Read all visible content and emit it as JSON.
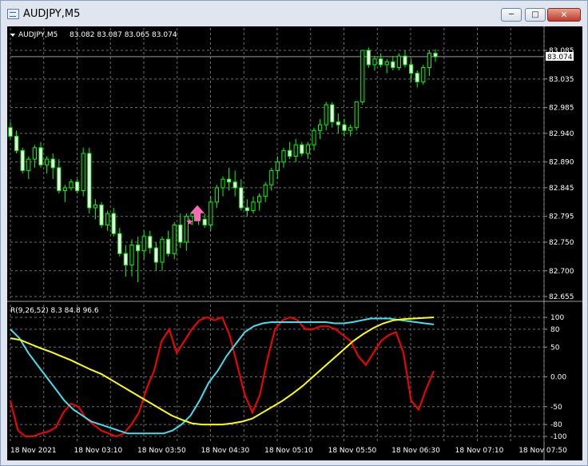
{
  "window": {
    "title": "AUDJPY,M5",
    "minimize_label": "─",
    "maximize_label": "□",
    "close_label": "✕"
  },
  "colors": {
    "background": "#000000",
    "grid": "#6e6e6e",
    "candle": "#00ff00",
    "bull_body": "#000000",
    "bear_body": "#ffffff",
    "rsi_red": "#ff0000",
    "rsi_cyan": "#40e0f0",
    "rsi_yellow": "#ffff00",
    "arrow_pink": "#ff69b4"
  },
  "icons": {
    "dropdown": "triangle-down-icon",
    "buy_arrow": "up-arrow-icon",
    "star": "star-icon"
  },
  "chart_data": [
    {
      "type": "candlestick",
      "symbol_label": "AUDJPY,M5",
      "ohlc_label": "83.082 83.087 83.065 83.074",
      "current_price_label": "83.074",
      "y_ticks": [
        "83.085",
        "83.035",
        "82.985",
        "82.940",
        "82.890",
        "82.845",
        "82.795",
        "82.750",
        "82.700",
        "82.655"
      ],
      "ylim": [
        82.655,
        83.085
      ],
      "candles": [
        [
          82.95,
          82.96,
          82.93,
          82.935
        ],
        [
          82.935,
          82.945,
          82.905,
          82.91
        ],
        [
          82.91,
          82.915,
          82.87,
          82.875
        ],
        [
          82.875,
          82.9,
          82.86,
          82.895
        ],
        [
          82.895,
          82.92,
          82.88,
          82.915
        ],
        [
          82.915,
          82.925,
          82.88,
          82.885
        ],
        [
          82.885,
          82.9,
          82.87,
          82.895
        ],
        [
          82.895,
          82.905,
          82.86,
          82.88
        ],
        [
          82.88,
          82.895,
          82.835,
          82.84
        ],
        [
          82.84,
          82.85,
          82.82,
          82.845
        ],
        [
          82.845,
          82.86,
          82.84,
          82.855
        ],
        [
          82.855,
          82.86,
          82.835,
          82.84
        ],
        [
          82.84,
          82.915,
          82.83,
          82.905
        ],
        [
          82.905,
          82.915,
          82.8,
          82.81
        ],
        [
          82.81,
          82.825,
          82.79,
          82.815
        ],
        [
          82.815,
          82.82,
          82.775,
          82.78
        ],
        [
          82.78,
          82.805,
          82.77,
          82.8
        ],
        [
          82.8,
          82.81,
          82.76,
          82.765
        ],
        [
          82.765,
          82.775,
          82.725,
          82.73
        ],
        [
          82.73,
          82.745,
          82.69,
          82.71
        ],
        [
          82.71,
          82.755,
          82.69,
          82.745
        ],
        [
          82.745,
          82.76,
          82.68,
          82.735
        ],
        [
          82.735,
          82.77,
          82.72,
          82.76
        ],
        [
          82.76,
          82.77,
          82.73,
          82.74
        ],
        [
          82.74,
          82.75,
          82.7,
          82.715
        ],
        [
          82.715,
          82.76,
          82.7,
          82.755
        ],
        [
          82.755,
          82.77,
          82.725,
          82.73
        ],
        [
          82.73,
          82.785,
          82.72,
          82.78
        ],
        [
          82.78,
          82.8,
          82.74,
          82.75
        ],
        [
          82.75,
          82.8,
          82.735,
          82.795
        ],
        [
          82.795,
          82.805,
          82.78,
          82.8
        ],
        [
          82.8,
          82.81,
          82.78,
          82.79
        ],
        [
          82.79,
          82.8,
          82.775,
          82.78
        ],
        [
          82.78,
          82.83,
          82.77,
          82.82
        ],
        [
          82.82,
          82.85,
          82.81,
          82.845
        ],
        [
          82.845,
          82.865,
          82.83,
          82.86
        ],
        [
          82.86,
          82.88,
          82.84,
          82.855
        ],
        [
          82.855,
          82.875,
          82.83,
          82.845
        ],
        [
          82.845,
          82.86,
          82.805,
          82.81
        ],
        [
          82.81,
          82.825,
          82.795,
          82.805
        ],
        [
          82.805,
          82.83,
          82.8,
          82.82
        ],
        [
          82.82,
          82.835,
          82.805,
          82.83
        ],
        [
          82.83,
          82.855,
          82.82,
          82.85
        ],
        [
          82.85,
          82.88,
          82.84,
          82.875
        ],
        [
          82.875,
          82.9,
          82.86,
          82.89
        ],
        [
          82.89,
          82.915,
          82.88,
          82.91
        ],
        [
          82.91,
          82.925,
          82.895,
          82.9
        ],
        [
          82.9,
          82.93,
          82.89,
          82.92
        ],
        [
          82.92,
          82.925,
          82.9,
          82.905
        ],
        [
          82.905,
          82.925,
          82.895,
          82.92
        ],
        [
          82.92,
          82.95,
          82.91,
          82.945
        ],
        [
          82.945,
          82.965,
          82.93,
          82.955
        ],
        [
          82.955,
          82.995,
          82.945,
          82.99
        ],
        [
          82.99,
          82.995,
          82.95,
          82.96
        ],
        [
          82.96,
          82.975,
          82.94,
          82.955
        ],
        [
          82.955,
          82.965,
          82.935,
          82.945
        ],
        [
          82.945,
          82.955,
          82.935,
          82.95
        ],
        [
          82.95,
          82.995,
          82.945,
          82.995
        ],
        [
          82.995,
          83.085,
          82.99,
          83.085
        ],
        [
          83.085,
          83.09,
          83.055,
          83.06
        ],
        [
          83.06,
          83.075,
          83.05,
          83.07
        ],
        [
          83.07,
          83.08,
          83.055,
          83.06
        ],
        [
          83.06,
          83.07,
          83.045,
          83.065
        ],
        [
          83.065,
          83.075,
          83.05,
          83.055
        ],
        [
          83.055,
          83.08,
          83.05,
          83.075
        ],
        [
          83.075,
          83.085,
          83.055,
          83.06
        ],
        [
          83.06,
          83.07,
          83.03,
          83.045
        ],
        [
          83.045,
          83.05,
          83.02,
          83.03
        ],
        [
          83.03,
          83.06,
          83.025,
          83.055
        ],
        [
          83.055,
          83.085,
          83.04,
          83.08
        ],
        [
          83.08,
          83.087,
          83.065,
          83.074
        ]
      ],
      "signal": {
        "type": "buy-arrow",
        "candle_index": 30,
        "price": 82.795
      }
    },
    {
      "type": "line",
      "indicator_label": "R(9,26,52) 8.3 84.8 96.6",
      "y_ticks": [
        "100",
        "80",
        "50",
        "0.00",
        "-50",
        "-80",
        "-100"
      ],
      "ylim": [
        -100,
        100
      ],
      "series": [
        {
          "color": "#ff0000",
          "values": [
            -40,
            -90,
            -100,
            -100,
            -95,
            -92,
            -85,
            -60,
            -45,
            -50,
            -70,
            -80,
            -90,
            -95,
            -100,
            -95,
            -80,
            -60,
            -20,
            10,
            60,
            80,
            40,
            60,
            80,
            95,
            100,
            95,
            100,
            70,
            20,
            -30,
            -60,
            -30,
            30,
            80,
            95,
            100,
            95,
            80,
            80,
            85,
            85,
            80,
            70,
            60,
            35,
            20,
            40,
            60,
            70,
            75,
            40,
            -40,
            -55,
            -20,
            10
          ]
        },
        {
          "color": "#40e0f0",
          "values": [
            80,
            65,
            40,
            20,
            0,
            -20,
            -40,
            -55,
            -65,
            -75,
            -80,
            -85,
            -90,
            -95,
            -95,
            -95,
            -95,
            -95,
            -90,
            -80,
            -65,
            -40,
            -10,
            10,
            35,
            55,
            75,
            85,
            90,
            92,
            92,
            92,
            92,
            92,
            92,
            92,
            90,
            90,
            92,
            95,
            98,
            98,
            98,
            96,
            94,
            92,
            90,
            88
          ]
        },
        {
          "color": "#ffff00",
          "values": [
            65,
            62,
            55,
            48,
            42,
            35,
            28,
            20,
            12,
            5,
            -5,
            -15,
            -25,
            -35,
            -45,
            -55,
            -65,
            -72,
            -78,
            -80,
            -80,
            -80,
            -78,
            -75,
            -70,
            -60,
            -50,
            -40,
            -28,
            -15,
            0,
            15,
            30,
            45,
            60,
            72,
            82,
            90,
            95,
            97,
            98,
            99,
            100
          ]
        }
      ]
    }
  ],
  "time_axis": [
    "18 Nov 2021",
    "18 Nov 03:10",
    "18 Nov 03:50",
    "18 Nov 04:30",
    "18 Nov 05:10",
    "18 Nov 05:50",
    "18 Nov 06:30",
    "18 Nov 07:10",
    "18 Nov 07:50"
  ]
}
